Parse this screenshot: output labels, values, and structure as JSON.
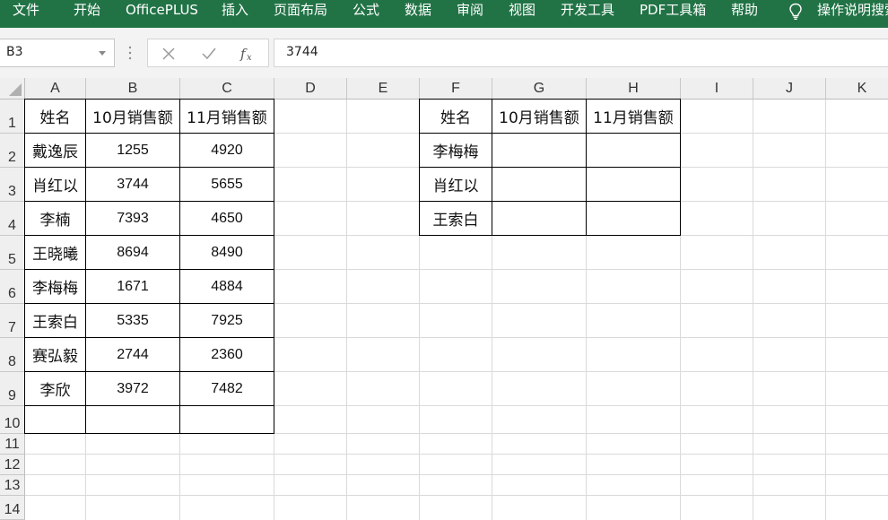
{
  "ribbon": {
    "tabs": [
      "文件",
      "开始",
      "OfficePLUS",
      "插入",
      "页面布局",
      "公式",
      "数据",
      "审阅",
      "视图",
      "开发工具",
      "PDF工具箱",
      "帮助"
    ],
    "tell_me": "操作说明搜索",
    "bg_color": "#217346"
  },
  "formula_bar": {
    "name_box": "B3",
    "formula": "3744",
    "icons": [
      "cancel-icon",
      "enter-icon",
      "insert-function-icon"
    ]
  },
  "grid": {
    "columns": [
      "A",
      "B",
      "C",
      "D",
      "E",
      "F",
      "G",
      "H",
      "I",
      "J",
      "K"
    ],
    "rows": [
      "1",
      "2",
      "3",
      "4",
      "5",
      "6",
      "7",
      "8",
      "9",
      "10",
      "11",
      "12",
      "13",
      "14"
    ]
  },
  "table_left": {
    "headers": [
      "姓名",
      "10月销售额",
      "11月销售额"
    ],
    "rows": [
      [
        "戴逸辰",
        "1255",
        "4920"
      ],
      [
        "肖红以",
        "3744",
        "5655"
      ],
      [
        "李楠",
        "7393",
        "4650"
      ],
      [
        "王晓曦",
        "8694",
        "8490"
      ],
      [
        "李梅梅",
        "1671",
        "4884"
      ],
      [
        "王索白",
        "5335",
        "7925"
      ],
      [
        "赛弘毅",
        "2744",
        "2360"
      ],
      [
        "李欣",
        "3972",
        "7482"
      ]
    ]
  },
  "table_right": {
    "headers": [
      "姓名",
      "10月销售额",
      "11月销售额"
    ],
    "names": [
      "李梅梅",
      "肖红以",
      "王索白"
    ]
  }
}
